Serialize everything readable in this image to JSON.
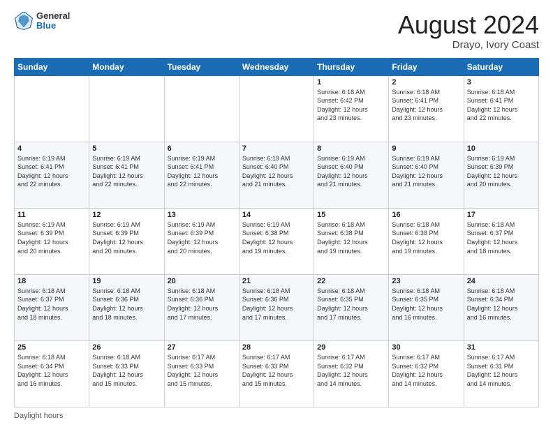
{
  "header": {
    "logo_line1": "General",
    "logo_line2": "Blue",
    "title": "August 2024",
    "location": "Drayo, Ivory Coast"
  },
  "days_of_week": [
    "Sunday",
    "Monday",
    "Tuesday",
    "Wednesday",
    "Thursday",
    "Friday",
    "Saturday"
  ],
  "footer_label": "Daylight hours",
  "weeks": [
    [
      {
        "day": "",
        "info": ""
      },
      {
        "day": "",
        "info": ""
      },
      {
        "day": "",
        "info": ""
      },
      {
        "day": "",
        "info": ""
      },
      {
        "day": "1",
        "info": "Sunrise: 6:18 AM\nSunset: 6:42 PM\nDaylight: 12 hours\nand 23 minutes."
      },
      {
        "day": "2",
        "info": "Sunrise: 6:18 AM\nSunset: 6:41 PM\nDaylight: 12 hours\nand 23 minutes."
      },
      {
        "day": "3",
        "info": "Sunrise: 6:18 AM\nSunset: 6:41 PM\nDaylight: 12 hours\nand 22 minutes."
      }
    ],
    [
      {
        "day": "4",
        "info": "Sunrise: 6:19 AM\nSunset: 6:41 PM\nDaylight: 12 hours\nand 22 minutes."
      },
      {
        "day": "5",
        "info": "Sunrise: 6:19 AM\nSunset: 6:41 PM\nDaylight: 12 hours\nand 22 minutes."
      },
      {
        "day": "6",
        "info": "Sunrise: 6:19 AM\nSunset: 6:41 PM\nDaylight: 12 hours\nand 22 minutes."
      },
      {
        "day": "7",
        "info": "Sunrise: 6:19 AM\nSunset: 6:40 PM\nDaylight: 12 hours\nand 21 minutes."
      },
      {
        "day": "8",
        "info": "Sunrise: 6:19 AM\nSunset: 6:40 PM\nDaylight: 12 hours\nand 21 minutes."
      },
      {
        "day": "9",
        "info": "Sunrise: 6:19 AM\nSunset: 6:40 PM\nDaylight: 12 hours\nand 21 minutes."
      },
      {
        "day": "10",
        "info": "Sunrise: 6:19 AM\nSunset: 6:39 PM\nDaylight: 12 hours\nand 20 minutes."
      }
    ],
    [
      {
        "day": "11",
        "info": "Sunrise: 6:19 AM\nSunset: 6:39 PM\nDaylight: 12 hours\nand 20 minutes."
      },
      {
        "day": "12",
        "info": "Sunrise: 6:19 AM\nSunset: 6:39 PM\nDaylight: 12 hours\nand 20 minutes."
      },
      {
        "day": "13",
        "info": "Sunrise: 6:19 AM\nSunset: 6:39 PM\nDaylight: 12 hours\nand 20 minutes."
      },
      {
        "day": "14",
        "info": "Sunrise: 6:19 AM\nSunset: 6:38 PM\nDaylight: 12 hours\nand 19 minutes."
      },
      {
        "day": "15",
        "info": "Sunrise: 6:18 AM\nSunset: 6:38 PM\nDaylight: 12 hours\nand 19 minutes."
      },
      {
        "day": "16",
        "info": "Sunrise: 6:18 AM\nSunset: 6:38 PM\nDaylight: 12 hours\nand 19 minutes."
      },
      {
        "day": "17",
        "info": "Sunrise: 6:18 AM\nSunset: 6:37 PM\nDaylight: 12 hours\nand 18 minutes."
      }
    ],
    [
      {
        "day": "18",
        "info": "Sunrise: 6:18 AM\nSunset: 6:37 PM\nDaylight: 12 hours\nand 18 minutes."
      },
      {
        "day": "19",
        "info": "Sunrise: 6:18 AM\nSunset: 6:36 PM\nDaylight: 12 hours\nand 18 minutes."
      },
      {
        "day": "20",
        "info": "Sunrise: 6:18 AM\nSunset: 6:36 PM\nDaylight: 12 hours\nand 17 minutes."
      },
      {
        "day": "21",
        "info": "Sunrise: 6:18 AM\nSunset: 6:36 PM\nDaylight: 12 hours\nand 17 minutes."
      },
      {
        "day": "22",
        "info": "Sunrise: 6:18 AM\nSunset: 6:35 PM\nDaylight: 12 hours\nand 17 minutes."
      },
      {
        "day": "23",
        "info": "Sunrise: 6:18 AM\nSunset: 6:35 PM\nDaylight: 12 hours\nand 16 minutes."
      },
      {
        "day": "24",
        "info": "Sunrise: 6:18 AM\nSunset: 6:34 PM\nDaylight: 12 hours\nand 16 minutes."
      }
    ],
    [
      {
        "day": "25",
        "info": "Sunrise: 6:18 AM\nSunset: 6:34 PM\nDaylight: 12 hours\nand 16 minutes."
      },
      {
        "day": "26",
        "info": "Sunrise: 6:18 AM\nSunset: 6:33 PM\nDaylight: 12 hours\nand 15 minutes."
      },
      {
        "day": "27",
        "info": "Sunrise: 6:17 AM\nSunset: 6:33 PM\nDaylight: 12 hours\nand 15 minutes."
      },
      {
        "day": "28",
        "info": "Sunrise: 6:17 AM\nSunset: 6:33 PM\nDaylight: 12 hours\nand 15 minutes."
      },
      {
        "day": "29",
        "info": "Sunrise: 6:17 AM\nSunset: 6:32 PM\nDaylight: 12 hours\nand 14 minutes."
      },
      {
        "day": "30",
        "info": "Sunrise: 6:17 AM\nSunset: 6:32 PM\nDaylight: 12 hours\nand 14 minutes."
      },
      {
        "day": "31",
        "info": "Sunrise: 6:17 AM\nSunset: 6:31 PM\nDaylight: 12 hours\nand 14 minutes."
      }
    ]
  ]
}
